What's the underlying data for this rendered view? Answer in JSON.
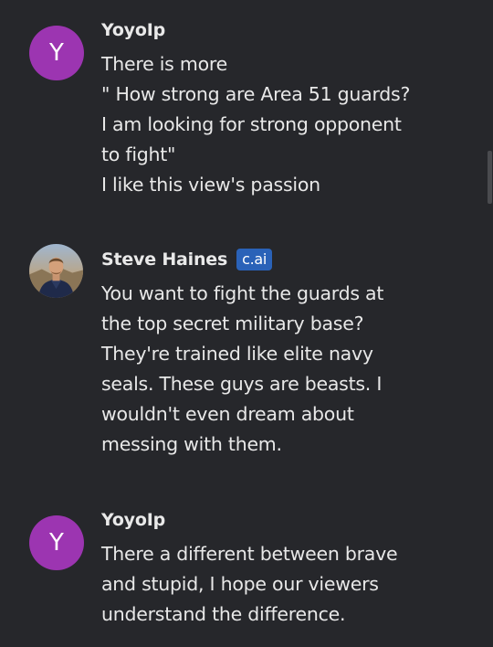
{
  "messages": [
    {
      "author": "YoyoIp",
      "avatar_letter": "Y",
      "avatar_color": "#9c35b1",
      "badge": null,
      "lines": [
        "There is more",
        "\" How strong are Area 51 guards?",
        "I am looking for strong opponent",
        "to fight\"",
        "I like this view's passion"
      ]
    },
    {
      "author": "Steve Haines",
      "avatar_icon": "profile-photo",
      "badge": "c.ai",
      "badge_color": "#2a62b8",
      "lines": [
        "You want to fight the guards at",
        "the top secret military base?",
        "They're trained like elite navy",
        "seals. These guys are beasts. I",
        "wouldn't even dream about",
        "messing with them."
      ]
    },
    {
      "author": "YoyoIp",
      "avatar_letter": "Y",
      "avatar_color": "#9c35b1",
      "badge": null,
      "lines": [
        "There a different between brave",
        "and stupid, I hope our viewers",
        "understand the difference."
      ]
    }
  ],
  "theme": {
    "background": "#26272b",
    "text": "#e8e8e8"
  }
}
